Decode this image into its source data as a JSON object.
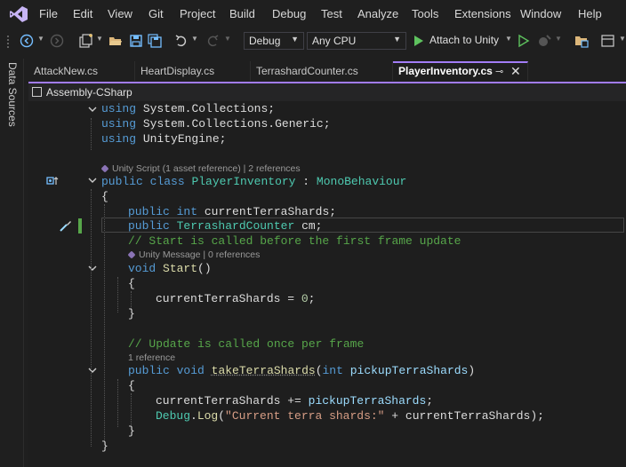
{
  "menu": [
    "File",
    "Edit",
    "View",
    "Git",
    "Project",
    "Build",
    "Debug",
    "Test",
    "Analyze",
    "Tools",
    "Extensions",
    "Window",
    "Help"
  ],
  "toolbar": {
    "config": "Debug",
    "platform": "Any CPU",
    "attach_label": "Attach to Unity"
  },
  "sidebar": {
    "label": "Data Sources"
  },
  "tabs": [
    {
      "label": "AttackNew.cs"
    },
    {
      "label": "HeartDisplay.cs"
    },
    {
      "label": "TerrashardCounter.cs"
    },
    {
      "label": "PlayerInventory.cs",
      "active": true
    }
  ],
  "navbar": {
    "project": "Assembly-CSharp"
  },
  "code": {
    "l1": [
      "using",
      "System",
      ".",
      "Collections",
      ";"
    ],
    "l2": [
      "using",
      "System",
      ".",
      "Collections",
      ".",
      "Generic",
      ";"
    ],
    "l3": [
      "using",
      "UnityEngine",
      ";"
    ],
    "lens1": "Unity Script (1 asset reference) | 2 references",
    "l5": [
      "public",
      "class",
      "PlayerInventory",
      ":",
      "MonoBehaviour"
    ],
    "l6": "{",
    "l7": [
      "public",
      "int",
      "currentTerraShards",
      ";"
    ],
    "l8": [
      "public",
      "TerrashardCounter",
      "cm",
      ";"
    ],
    "l9": "// Start is called before the first frame update",
    "lens2": "Unity Message | 0 references",
    "l10": [
      "void",
      "Start",
      "()"
    ],
    "l11": "{",
    "l12": [
      "currentTerraShards",
      " = ",
      "0",
      ";"
    ],
    "l13": "}",
    "l15": "// Update is called once per frame",
    "lens3": "1 reference",
    "l16": [
      "public",
      "void",
      "takeTerraShards",
      "(",
      "int",
      "pickupTerraShards",
      ")"
    ],
    "l17": "{",
    "l18": [
      "currentTerraShards",
      " += ",
      "pickupTerraShards",
      ";"
    ],
    "l19": [
      "Debug",
      ".",
      "Log",
      "(",
      "\"Current terra shards:\"",
      " + ",
      "currentTerraShards",
      ");"
    ],
    "l20": "}",
    "l21": "}"
  },
  "colors": {
    "accent": "#a27cf6",
    "keyword": "#569cd6",
    "type": "#4ec9b0",
    "comment": "#57a64a",
    "string": "#d69d85"
  }
}
